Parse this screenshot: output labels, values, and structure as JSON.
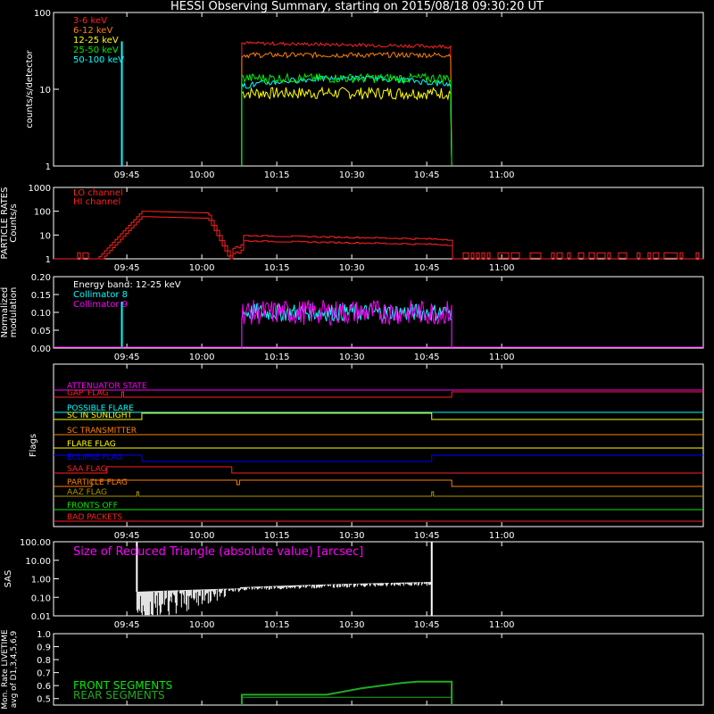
{
  "title": "HESSI Observing Summary, starting on 2015/08/18 09:30:20 UT",
  "colors": {
    "red": "#ff2020",
    "orange": "#ff8000",
    "yellow": "#ffff00",
    "green": "#00ee00",
    "cyan": "#00ffff",
    "magenta": "#ff00ff",
    "blue": "#0000ff",
    "olive": "#aa9900",
    "dkgreen": "#22aa22"
  },
  "time_axis": {
    "ticks": [
      "09:45",
      "10:00",
      "10:15",
      "10:30",
      "10:45",
      "11:00"
    ]
  },
  "chart_data": [
    {
      "id": "counts",
      "type": "line",
      "ylabel": "counts/s/detector",
      "yscale": "log",
      "ylim": [
        1,
        100
      ],
      "yticks": [
        "1",
        "10",
        "100"
      ],
      "legend": [
        "3-6 keV",
        "6-12 keV",
        "12-25 keV",
        "25-50 keV",
        "50-100 keV"
      ],
      "series": [
        {
          "name": "3-6 keV",
          "level": 40,
          "noise": 0.05
        },
        {
          "name": "6-12 keV",
          "level": 28,
          "noise": 0.08
        },
        {
          "name": "12-25 keV",
          "level": 9,
          "noise": 0.18
        },
        {
          "name": "25-50 keV",
          "level": 14,
          "noise": 0.14
        },
        {
          "name": "50-100 keV",
          "level": 11,
          "noise": 0.16
        }
      ],
      "observation_window": [
        "10:08",
        "10:50"
      ]
    },
    {
      "id": "particle",
      "type": "line",
      "ylabel": "PARTICLE RATES Counts/s",
      "yscale": "log",
      "ylim": [
        1,
        1000
      ],
      "yticks": [
        "1",
        "10",
        "100",
        "1000"
      ],
      "legend": [
        "LO channel",
        "HI channel"
      ],
      "series": [
        {
          "name": "LO channel"
        },
        {
          "name": "HI channel"
        }
      ]
    },
    {
      "id": "modulation",
      "type": "line",
      "ylabel": "Normalized modulation",
      "ylim": [
        0,
        0.2
      ],
      "yticks": [
        "0.00",
        "0.05",
        "0.10",
        "0.15",
        "0.20"
      ],
      "legend": [
        "Energy band: 12-25 keV",
        "Collimator 8",
        "Collimator 9"
      ],
      "series": [
        {
          "name": "Collimator 8",
          "level": 0.1
        },
        {
          "name": "Collimator 9",
          "level": 0.1
        }
      ]
    },
    {
      "id": "flags",
      "type": "line",
      "ylabel": "Flags",
      "flags": [
        {
          "name": "ATTENUATOR STATE",
          "color": "magenta"
        },
        {
          "name": "GAP_FLAG",
          "color": "red"
        },
        {
          "name": "POSSIBLE FLARE",
          "color": "cyan"
        },
        {
          "name": "SC IN SUNLIGHT",
          "color": "yellow"
        },
        {
          "name": "SC TRANSMITTER",
          "color": "orange"
        },
        {
          "name": "FLARE FLAG",
          "color": "yellow"
        },
        {
          "name": "ECLIPSE FLAG",
          "color": "blue"
        },
        {
          "name": "SAA FLAG",
          "color": "red"
        },
        {
          "name": "PARTICLE FLAG",
          "color": "orange"
        },
        {
          "name": "AAZ FLAG",
          "color": "olive"
        },
        {
          "name": "FRONTS OFF",
          "color": "green"
        },
        {
          "name": "BAD PACKETS",
          "color": "red"
        }
      ]
    },
    {
      "id": "sas",
      "type": "line",
      "ylabel": "SAS",
      "yscale": "log",
      "ylim": [
        0.01,
        100
      ],
      "yticks": [
        "0.01",
        "0.10",
        "1.00",
        "10.00",
        "100.00"
      ],
      "legend": [
        "Size of Reduced Triangle (absolute value) [arcsec]"
      ]
    },
    {
      "id": "livetime",
      "type": "line",
      "ylabel": "Mon. Rate LIVETIME avg of D1,3,4,5,6,9",
      "ylim": [
        0.45,
        1.0
      ],
      "yticks": [
        "0.5",
        "0.6",
        "0.7",
        "0.8",
        "0.9",
        "1.0"
      ],
      "legend": [
        "FRONT SEGMENTS",
        "REAR SEGMENTS"
      ],
      "series": [
        {
          "name": "FRONT SEGMENTS"
        },
        {
          "name": "REAR SEGMENTS"
        }
      ]
    }
  ]
}
